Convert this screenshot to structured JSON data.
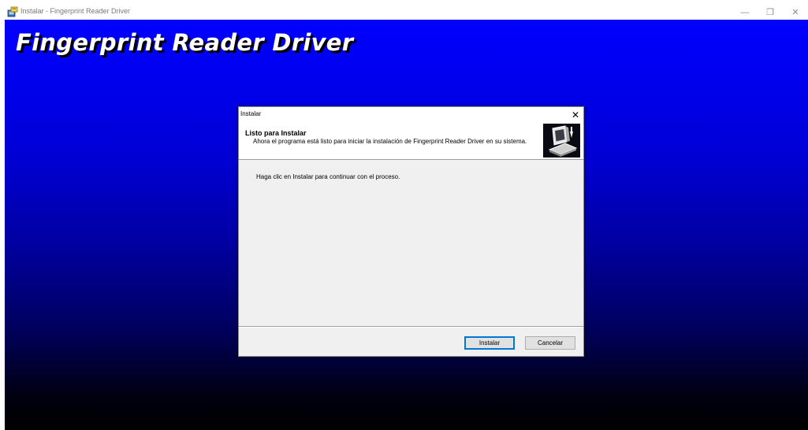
{
  "window": {
    "title": "Instalar - Fingerprint Reader Driver",
    "icon": "setup-icon",
    "controls": {
      "minimize": "—",
      "restore": "❐",
      "close": "✕"
    }
  },
  "banner": {
    "title": "Fingerprint Reader Driver"
  },
  "dialog": {
    "title": "Instalar",
    "close_glyph": "✕",
    "header": {
      "title": "Listo para Instalar",
      "description": "Ahora el programa está listo para iniciar la instalación de Fingerprint Reader Driver en su sistema.",
      "icon": "install-computer-icon"
    },
    "body": {
      "text": "Haga clic en Instalar para continuar con el proceso."
    },
    "buttons": {
      "install": "Instalar",
      "cancel": "Cancelar"
    }
  },
  "colors": {
    "desktop_gradient_top": "#0000ff",
    "desktop_gradient_bottom": "#000000",
    "dialog_background": "#f0f0f0",
    "accent": "#0078d7"
  }
}
